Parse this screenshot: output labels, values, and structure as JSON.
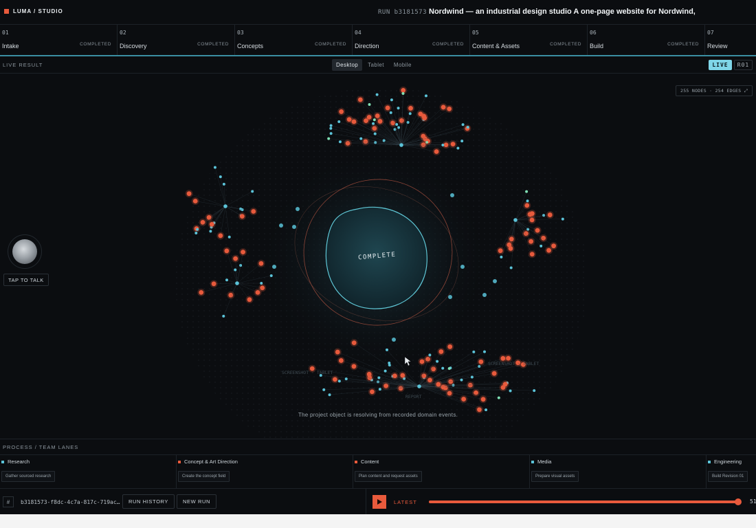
{
  "brand": {
    "name": "LUMA / STUDIO"
  },
  "run": {
    "id_label": "RUN b3181573",
    "title": "Nordwind — an industrial design studio A one-page website for Nordwind,"
  },
  "steps": [
    {
      "num": "01",
      "name": "Intake",
      "status": "COMPLETED"
    },
    {
      "num": "02",
      "name": "Discovery",
      "status": "COMPLETED"
    },
    {
      "num": "03",
      "name": "Concepts",
      "status": "COMPLETED"
    },
    {
      "num": "04",
      "name": "Direction",
      "status": "COMPLETED"
    },
    {
      "num": "05",
      "name": "Content & Assets",
      "status": "COMPLETED"
    },
    {
      "num": "06",
      "name": "Build",
      "status": "COMPLETED"
    },
    {
      "num": "07",
      "name": "Review",
      "status": ""
    }
  ],
  "live_result": {
    "label": "LIVE RESULT",
    "device_tabs": [
      "Desktop",
      "Tablet",
      "Mobile"
    ],
    "active_tab": "Desktop",
    "live_label": "LIVE",
    "revision_label": "R01"
  },
  "graph": {
    "stats": "255 NODES · 254 EDGES ⤢",
    "center_label": "COMPLETE",
    "status_message": "The project object is resolving from recorded domain events.",
    "faint_labels": [
      "SCREENSHOT · TABLET",
      "SCREENSHOT · TABLET",
      "REPORT"
    ],
    "colors": {
      "primary": "#e85a3c",
      "secondary": "#5bc3d8",
      "accent": "#7fe0b4"
    }
  },
  "voice": {
    "talk_label": "TAP TO TALK"
  },
  "lanes": {
    "title": "PROCESS / TEAM LANES",
    "items": [
      {
        "name": "Research",
        "task": "Gather sourced research",
        "color": "#5bc3d8"
      },
      {
        "name": "Concept & Art Direction",
        "task": "Create the concept field",
        "color": "#e85a3c"
      },
      {
        "name": "Content",
        "task": "Plan content and request assets",
        "color": "#e85a3c"
      },
      {
        "name": "Media",
        "task": "Prepare visual assets",
        "color": "#5bc3d8"
      },
      {
        "name": "Engineering",
        "task": "Build Revision 01",
        "color": "#5bc3d8"
      }
    ]
  },
  "bottom": {
    "hash_icon": "#",
    "run_ref": "b3181573-f8dc-4c7a-817c-719ac…",
    "history_label": "RUN HISTORY",
    "new_run_label": "NEW RUN",
    "latest_label": "LATEST",
    "timeline_progress": 0.99,
    "end_number": "51"
  }
}
